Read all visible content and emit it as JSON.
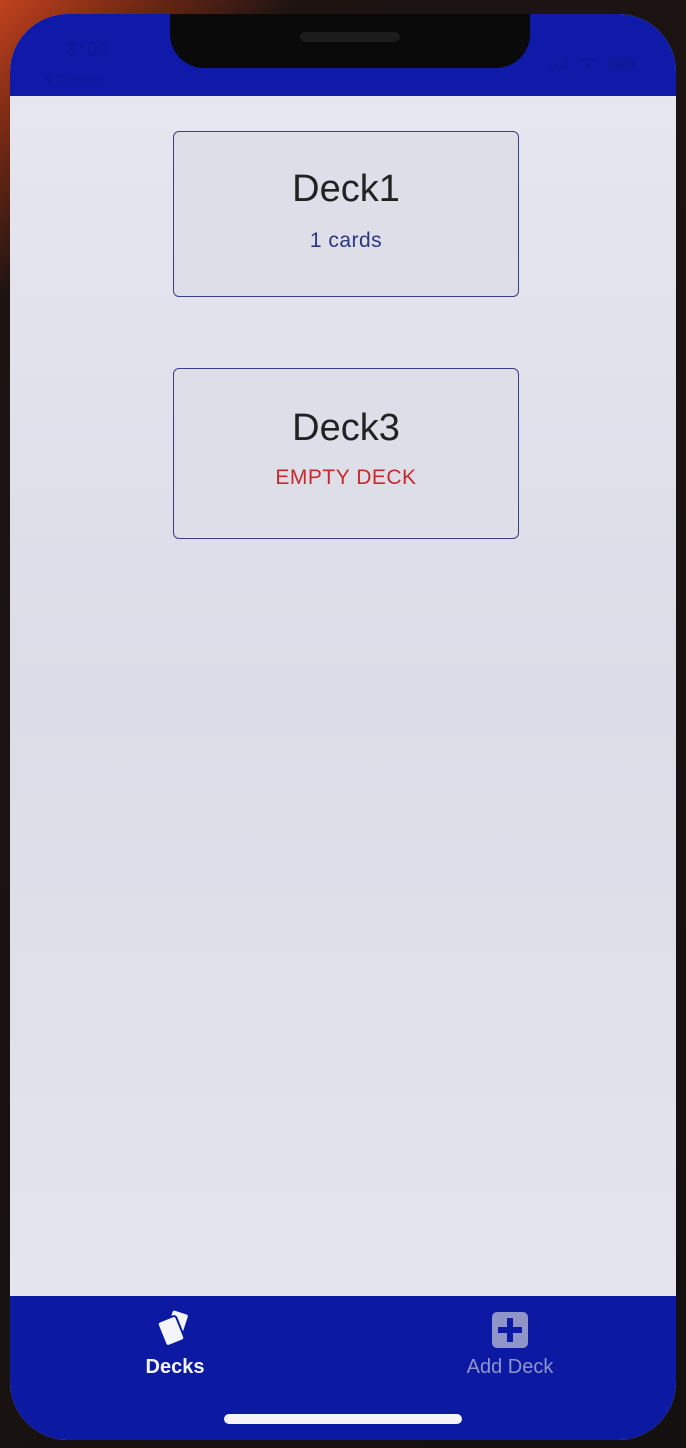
{
  "status_bar": {
    "time": "3:01",
    "back_label": "◂ Camera"
  },
  "decks": [
    {
      "title": "Deck1",
      "subtitle": "1 cards",
      "empty": false
    },
    {
      "title": "Deck3",
      "subtitle": "EMPTY DECK",
      "empty": true
    }
  ],
  "tab_bar": {
    "tabs": [
      {
        "label": "Decks",
        "icon": "cards-icon",
        "active": true
      },
      {
        "label": "Add Deck",
        "icon": "plus-square-icon",
        "active": false
      }
    ]
  },
  "colors": {
    "accent": "#0b19a3",
    "empty_text": "#c62a2a",
    "count_text": "#2c3780"
  }
}
